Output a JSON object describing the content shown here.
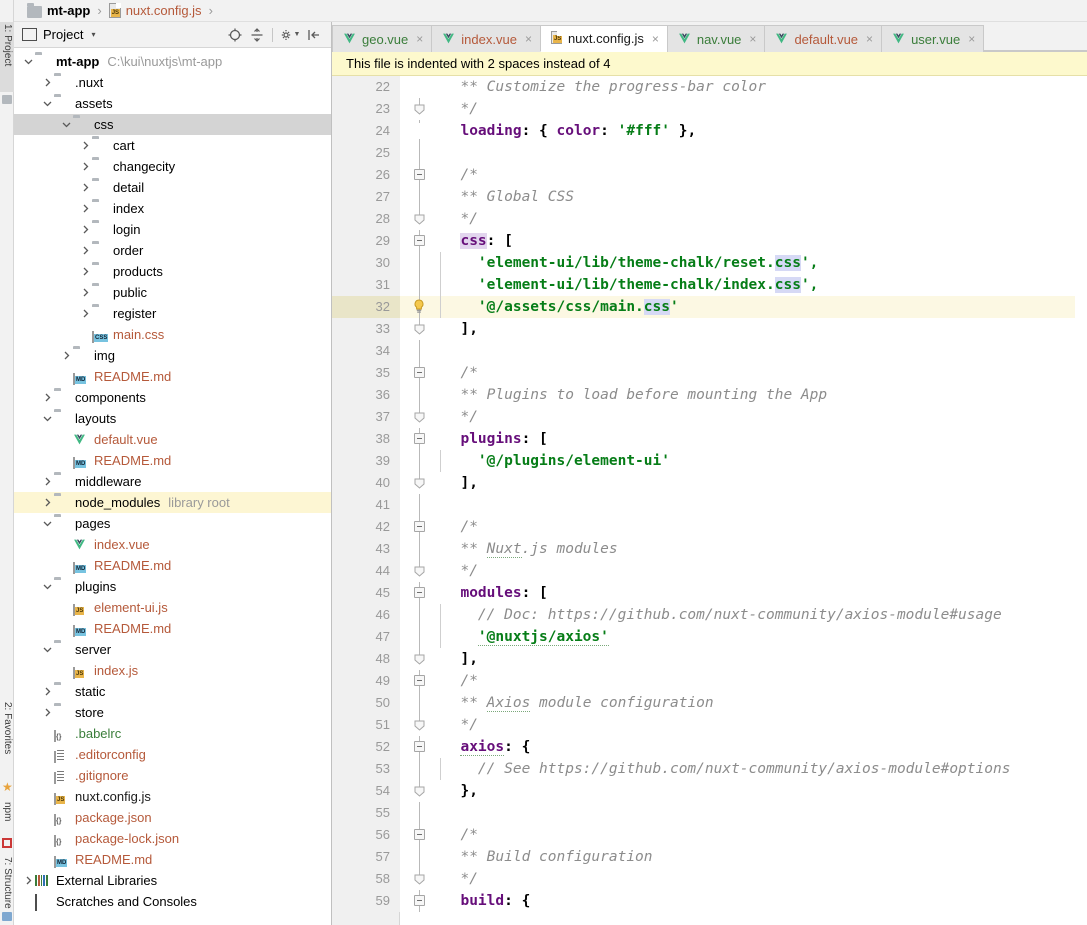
{
  "breadcrumb": {
    "project_name": "mt-app",
    "file_name": "nuxt.config.js",
    "separator": "›"
  },
  "left_tool_strip": {
    "tabs": [
      {
        "label": "1: Project",
        "icon": "project-icon",
        "active": true
      },
      {
        "label": "2: Favorites",
        "icon": "star-icon",
        "active": false
      },
      {
        "label": "npm",
        "icon": "npm-icon",
        "active": false
      },
      {
        "label": "7: Structure",
        "icon": "structure-icon",
        "active": false
      }
    ]
  },
  "project_panel": {
    "title": "Project",
    "caret": "▾",
    "tools": [
      {
        "name": "locate-icon",
        "glyph": "⊕"
      },
      {
        "name": "collapse-all-icon",
        "glyph": "‡"
      },
      {
        "name": "settings-gear-icon",
        "glyph": "⚙"
      },
      {
        "name": "hide-panel-icon",
        "glyph": "⇥"
      }
    ],
    "tree": [
      {
        "depth": 0,
        "arrow": "down",
        "icon": "folder",
        "label": "mt-app",
        "bold": true,
        "suffix": "C:\\kui\\nuxtjs\\mt-app"
      },
      {
        "depth": 1,
        "arrow": "right",
        "icon": "folder",
        "label": ".nuxt"
      },
      {
        "depth": 1,
        "arrow": "down",
        "icon": "folder",
        "label": "assets"
      },
      {
        "depth": 2,
        "arrow": "down",
        "icon": "folder",
        "label": "css",
        "selected": true
      },
      {
        "depth": 3,
        "arrow": "right",
        "icon": "folder",
        "label": "cart"
      },
      {
        "depth": 3,
        "arrow": "right",
        "icon": "folder",
        "label": "changecity"
      },
      {
        "depth": 3,
        "arrow": "right",
        "icon": "folder",
        "label": "detail"
      },
      {
        "depth": 3,
        "arrow": "right",
        "icon": "folder",
        "label": "index"
      },
      {
        "depth": 3,
        "arrow": "right",
        "icon": "folder",
        "label": "login"
      },
      {
        "depth": 3,
        "arrow": "right",
        "icon": "folder",
        "label": "order"
      },
      {
        "depth": 3,
        "arrow": "right",
        "icon": "folder",
        "label": "products"
      },
      {
        "depth": 3,
        "arrow": "right",
        "icon": "folder",
        "label": "public"
      },
      {
        "depth": 3,
        "arrow": "right",
        "icon": "folder",
        "label": "register"
      },
      {
        "depth": 3,
        "arrow": "none",
        "icon": "file-css",
        "label": "main.css",
        "color": "red"
      },
      {
        "depth": 2,
        "arrow": "right",
        "icon": "folder",
        "label": "img"
      },
      {
        "depth": 2,
        "arrow": "none",
        "icon": "file-md",
        "label": "README.md",
        "color": "red"
      },
      {
        "depth": 1,
        "arrow": "right",
        "icon": "folder",
        "label": "components"
      },
      {
        "depth": 1,
        "arrow": "down",
        "icon": "folder",
        "label": "layouts"
      },
      {
        "depth": 2,
        "arrow": "none",
        "icon": "file-vue",
        "label": "default.vue",
        "color": "red"
      },
      {
        "depth": 2,
        "arrow": "none",
        "icon": "file-md",
        "label": "README.md",
        "color": "red"
      },
      {
        "depth": 1,
        "arrow": "right",
        "icon": "folder",
        "label": "middleware"
      },
      {
        "depth": 1,
        "arrow": "right",
        "icon": "folder",
        "label": "node_modules",
        "suffix": "library root",
        "highlight": true
      },
      {
        "depth": 1,
        "arrow": "down",
        "icon": "folder",
        "label": "pages"
      },
      {
        "depth": 2,
        "arrow": "none",
        "icon": "file-vue",
        "label": "index.vue",
        "color": "red"
      },
      {
        "depth": 2,
        "arrow": "none",
        "icon": "file-md",
        "label": "README.md",
        "color": "red"
      },
      {
        "depth": 1,
        "arrow": "down",
        "icon": "folder",
        "label": "plugins"
      },
      {
        "depth": 2,
        "arrow": "none",
        "icon": "file-js",
        "label": "element-ui.js",
        "color": "red"
      },
      {
        "depth": 2,
        "arrow": "none",
        "icon": "file-md",
        "label": "README.md",
        "color": "red"
      },
      {
        "depth": 1,
        "arrow": "down",
        "icon": "folder",
        "label": "server"
      },
      {
        "depth": 2,
        "arrow": "none",
        "icon": "file-js",
        "label": "index.js",
        "color": "red"
      },
      {
        "depth": 1,
        "arrow": "right",
        "icon": "folder",
        "label": "static"
      },
      {
        "depth": 1,
        "arrow": "right",
        "icon": "folder",
        "label": "store"
      },
      {
        "depth": 1,
        "arrow": "none",
        "icon": "file-json",
        "label": ".babelrc",
        "color": "green"
      },
      {
        "depth": 1,
        "arrow": "none",
        "icon": "file-txt",
        "label": ".editorconfig",
        "color": "red"
      },
      {
        "depth": 1,
        "arrow": "none",
        "icon": "file-txt",
        "label": ".gitignore",
        "color": "red"
      },
      {
        "depth": 1,
        "arrow": "none",
        "icon": "file-js",
        "label": "nuxt.config.js",
        "color": "dark"
      },
      {
        "depth": 1,
        "arrow": "none",
        "icon": "file-json",
        "label": "package.json",
        "color": "red"
      },
      {
        "depth": 1,
        "arrow": "none",
        "icon": "file-json",
        "label": "package-lock.json",
        "color": "red"
      },
      {
        "depth": 1,
        "arrow": "none",
        "icon": "file-md",
        "label": "README.md",
        "color": "red"
      },
      {
        "depth": 0,
        "arrow": "right",
        "icon": "library",
        "label": "External Libraries"
      },
      {
        "depth": 0,
        "arrow": "none",
        "icon": "scratches",
        "label": "Scratches and Consoles"
      }
    ]
  },
  "editor": {
    "tabs": [
      {
        "label": "geo.vue",
        "icon": "vue-icon",
        "style": "geo",
        "active": false,
        "close": "×"
      },
      {
        "label": "index.vue",
        "icon": "vue-icon",
        "style": "vue",
        "active": false,
        "close": "×"
      },
      {
        "label": "nuxt.config.js",
        "icon": "js-icon",
        "style": "js",
        "active": true,
        "close": "×"
      },
      {
        "label": "nav.vue",
        "icon": "vue-icon",
        "style": "geo",
        "active": false,
        "close": "×"
      },
      {
        "label": "default.vue",
        "icon": "vue-icon",
        "style": "vue",
        "active": false,
        "close": "×"
      },
      {
        "label": "user.vue",
        "icon": "vue-icon",
        "style": "geo",
        "active": false,
        "close": "×"
      }
    ],
    "notice": "This file is indented with 2 spaces instead of 4",
    "current_line": 32,
    "lines": [
      {
        "n": 22,
        "fold": "none",
        "text": "  ** Customize the progress-bar color",
        "cls": "t-cmt"
      },
      {
        "n": 23,
        "fold": "end",
        "text": "  */",
        "cls": "t-cmt"
      },
      {
        "n": 24,
        "fold": "none",
        "caret": true,
        "tokens": [
          {
            "t": "  ",
            "c": "t-plain"
          },
          {
            "t": "loading",
            "c": "t-kw"
          },
          {
            "t": ": { ",
            "c": "t-pun"
          },
          {
            "t": "color",
            "c": "t-kw"
          },
          {
            "t": ": ",
            "c": "t-pun"
          },
          {
            "t": "'#fff'",
            "c": "t-str"
          },
          {
            "t": " },",
            "c": "t-pun"
          }
        ]
      },
      {
        "n": 25,
        "fold": "none",
        "text": ""
      },
      {
        "n": 26,
        "fold": "start",
        "text": "  /*",
        "cls": "t-cmt"
      },
      {
        "n": 27,
        "fold": "none",
        "text": "  ** Global CSS",
        "cls": "t-cmt"
      },
      {
        "n": 28,
        "fold": "end",
        "text": "  */",
        "cls": "t-cmt"
      },
      {
        "n": 29,
        "fold": "start",
        "tokens": [
          {
            "t": "  ",
            "c": "t-plain"
          },
          {
            "t": "css",
            "c": "t-kw",
            "bg": "hlkw"
          },
          {
            "t": ": [",
            "c": "t-pun"
          }
        ]
      },
      {
        "n": 30,
        "fold": "none",
        "indent": true,
        "tokens": [
          {
            "t": "    ",
            "c": "t-plain"
          },
          {
            "t": "'element-ui/lib/theme-chalk/reset.",
            "c": "t-str"
          },
          {
            "t": "css",
            "c": "t-str",
            "bg": "hlsel"
          },
          {
            "t": "',",
            "c": "t-str"
          }
        ]
      },
      {
        "n": 31,
        "fold": "none",
        "indent": true,
        "tokens": [
          {
            "t": "    ",
            "c": "t-plain"
          },
          {
            "t": "'element-ui/lib/theme-chalk/index.",
            "c": "t-str"
          },
          {
            "t": "css",
            "c": "t-str",
            "bg": "hlsel"
          },
          {
            "t": "',",
            "c": "t-str"
          }
        ]
      },
      {
        "n": 32,
        "fold": "none",
        "bulb": true,
        "indent": true,
        "current": true,
        "tokens": [
          {
            "t": "    ",
            "c": "t-plain"
          },
          {
            "t": "'@/assets/css/main.",
            "c": "t-str"
          },
          {
            "t": "css",
            "c": "t-str",
            "bg": "hlsel"
          },
          {
            "t": "'",
            "c": "t-str"
          }
        ]
      },
      {
        "n": 33,
        "fold": "end",
        "tokens": [
          {
            "t": "  ],",
            "c": "t-pun"
          }
        ]
      },
      {
        "n": 34,
        "fold": "none",
        "text": ""
      },
      {
        "n": 35,
        "fold": "start",
        "text": "  /*",
        "cls": "t-cmt"
      },
      {
        "n": 36,
        "fold": "none",
        "text": "  ** Plugins to load before mounting the App",
        "cls": "t-cmt"
      },
      {
        "n": 37,
        "fold": "end",
        "text": "  */",
        "cls": "t-cmt"
      },
      {
        "n": 38,
        "fold": "start",
        "tokens": [
          {
            "t": "  ",
            "c": "t-plain"
          },
          {
            "t": "plugins",
            "c": "t-kw"
          },
          {
            "t": ": [",
            "c": "t-pun"
          }
        ]
      },
      {
        "n": 39,
        "fold": "none",
        "indent": true,
        "tokens": [
          {
            "t": "    ",
            "c": "t-plain"
          },
          {
            "t": "'@/plugins/element-ui'",
            "c": "t-str"
          }
        ]
      },
      {
        "n": 40,
        "fold": "end",
        "tokens": [
          {
            "t": "  ],",
            "c": "t-pun"
          }
        ]
      },
      {
        "n": 41,
        "fold": "none",
        "text": ""
      },
      {
        "n": 42,
        "fold": "start",
        "text": "  /*",
        "cls": "t-cmt"
      },
      {
        "n": 43,
        "fold": "none",
        "tokens": [
          {
            "t": "  ** ",
            "c": "t-cmt"
          },
          {
            "t": "Nuxt",
            "c": "t-cmt",
            "sq": true
          },
          {
            "t": ".js modules",
            "c": "t-cmt"
          }
        ]
      },
      {
        "n": 44,
        "fold": "end",
        "text": "  */",
        "cls": "t-cmt"
      },
      {
        "n": 45,
        "fold": "start",
        "tokens": [
          {
            "t": "  ",
            "c": "t-plain"
          },
          {
            "t": "modules",
            "c": "t-kw"
          },
          {
            "t": ": [",
            "c": "t-pun"
          }
        ]
      },
      {
        "n": 46,
        "fold": "none",
        "indent": true,
        "text": "    // Doc: https://github.com/nuxt-community/axios-module#usage",
        "cls": "t-cmt"
      },
      {
        "n": 47,
        "fold": "none",
        "indent": true,
        "tokens": [
          {
            "t": "    ",
            "c": "t-plain"
          },
          {
            "t": "'@nuxtjs/axios'",
            "c": "t-str",
            "sq": true
          }
        ]
      },
      {
        "n": 48,
        "fold": "end",
        "tokens": [
          {
            "t": "  ],",
            "c": "t-pun"
          }
        ]
      },
      {
        "n": 49,
        "fold": "start",
        "text": "  /*",
        "cls": "t-cmt"
      },
      {
        "n": 50,
        "fold": "none",
        "tokens": [
          {
            "t": "  ** ",
            "c": "t-cmt"
          },
          {
            "t": "Axios",
            "c": "t-cmt",
            "sq": true
          },
          {
            "t": " module configuration",
            "c": "t-cmt"
          }
        ]
      },
      {
        "n": 51,
        "fold": "end",
        "text": "  */",
        "cls": "t-cmt"
      },
      {
        "n": 52,
        "fold": "start",
        "tokens": [
          {
            "t": "  ",
            "c": "t-plain"
          },
          {
            "t": "axios",
            "c": "t-kw",
            "sq": true
          },
          {
            "t": ": {",
            "c": "t-pun"
          }
        ]
      },
      {
        "n": 53,
        "fold": "none",
        "indent": true,
        "text": "    // See https://github.com/nuxt-community/axios-module#options",
        "cls": "t-cmt"
      },
      {
        "n": 54,
        "fold": "end",
        "tokens": [
          {
            "t": "  },",
            "c": "t-pun"
          }
        ]
      },
      {
        "n": 55,
        "fold": "none",
        "text": ""
      },
      {
        "n": 56,
        "fold": "start",
        "text": "  /*",
        "cls": "t-cmt"
      },
      {
        "n": 57,
        "fold": "none",
        "text": "  ** Build configuration",
        "cls": "t-cmt"
      },
      {
        "n": 58,
        "fold": "end",
        "text": "  */",
        "cls": "t-cmt"
      },
      {
        "n": 59,
        "fold": "start",
        "tokens": [
          {
            "t": "  ",
            "c": "t-plain"
          },
          {
            "t": "build",
            "c": "t-kw"
          },
          {
            "t": ": {",
            "c": "t-pun"
          }
        ]
      }
    ]
  },
  "colors": {
    "panel_bg": "#f2f2f2",
    "editor_bg": "#ffffff",
    "selection": "#d4d4d4",
    "highlight_row": "#fdf6d3",
    "notice_bg": "#fdf9cd",
    "current_line": "#fcf8e3",
    "string_green": "#067d17",
    "keyword_purple": "#660e7a",
    "comment_gray": "#8c8c8c",
    "file_red": "#b5593a",
    "vue_green": "#41b883"
  }
}
